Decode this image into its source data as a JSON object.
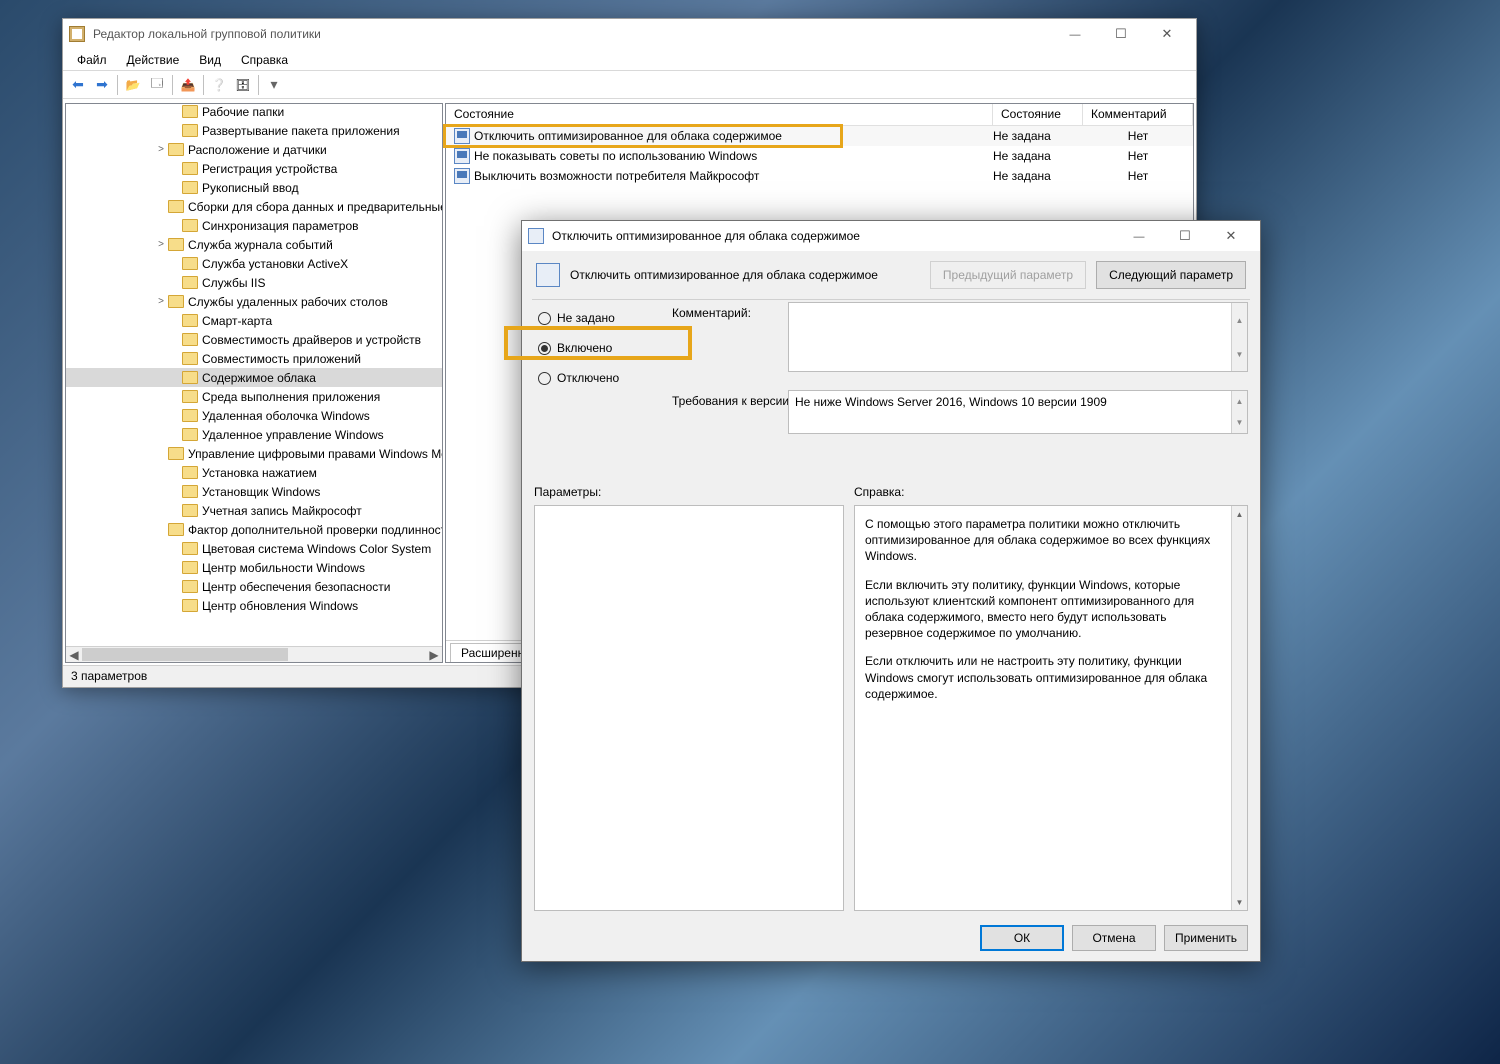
{
  "main": {
    "title": "Редактор локальной групповой политики",
    "menu": {
      "file": "Файл",
      "action": "Действие",
      "view": "Вид",
      "help": "Справка"
    },
    "status": "3 параметров",
    "tree": [
      {
        "indent": 3,
        "exp": "",
        "label": "Рабочие папки"
      },
      {
        "indent": 3,
        "exp": "",
        "label": "Развертывание пакета приложения"
      },
      {
        "indent": 2,
        "exp": ">",
        "label": "Расположение и датчики"
      },
      {
        "indent": 3,
        "exp": "",
        "label": "Регистрация устройства"
      },
      {
        "indent": 3,
        "exp": "",
        "label": "Рукописный ввод"
      },
      {
        "indent": 3,
        "exp": "",
        "label": "Сборки для сбора данных и предварительные сборки"
      },
      {
        "indent": 3,
        "exp": "",
        "label": "Синхронизация параметров"
      },
      {
        "indent": 2,
        "exp": ">",
        "label": "Служба журнала событий"
      },
      {
        "indent": 3,
        "exp": "",
        "label": "Служба установки ActiveX"
      },
      {
        "indent": 3,
        "exp": "",
        "label": "Службы IIS"
      },
      {
        "indent": 2,
        "exp": ">",
        "label": "Службы удаленных рабочих столов"
      },
      {
        "indent": 3,
        "exp": "",
        "label": "Смарт-карта"
      },
      {
        "indent": 3,
        "exp": "",
        "label": "Совместимость драйверов и устройств"
      },
      {
        "indent": 3,
        "exp": "",
        "label": "Совместимость приложений"
      },
      {
        "indent": 3,
        "exp": "",
        "label": "Содержимое облака",
        "sel": true
      },
      {
        "indent": 3,
        "exp": "",
        "label": "Среда выполнения приложения"
      },
      {
        "indent": 3,
        "exp": "",
        "label": "Удаленная оболочка Windows"
      },
      {
        "indent": 3,
        "exp": "",
        "label": "Удаленное управление Windows"
      },
      {
        "indent": 3,
        "exp": "",
        "label": "Управление цифровыми правами Windows Media"
      },
      {
        "indent": 3,
        "exp": "",
        "label": "Установка нажатием"
      },
      {
        "indent": 3,
        "exp": "",
        "label": "Установщик Windows"
      },
      {
        "indent": 3,
        "exp": "",
        "label": "Учетная запись Майкрософт"
      },
      {
        "indent": 3,
        "exp": "",
        "label": "Фактор дополнительной проверки подлинности"
      },
      {
        "indent": 3,
        "exp": "",
        "label": "Цветовая система Windows Color System"
      },
      {
        "indent": 3,
        "exp": "",
        "label": "Центр мобильности Windows"
      },
      {
        "indent": 3,
        "exp": "",
        "label": "Центр обеспечения безопасности"
      },
      {
        "indent": 3,
        "exp": "",
        "label": "Центр обновления Windows"
      }
    ],
    "list": {
      "header": {
        "name": "Состояние",
        "state": "Состояние",
        "comment": "Комментарий"
      },
      "rows": [
        {
          "name": "Отключить оптимизированное для облака содержимое",
          "state": "Не задана",
          "comment": "Нет",
          "hl": true
        },
        {
          "name": "Не показывать советы по использованию Windows",
          "state": "Не задана",
          "comment": "Нет"
        },
        {
          "name": "Выключить возможности потребителя Майкрософт",
          "state": "Не задана",
          "comment": "Нет"
        }
      ],
      "tab": "Расширенный"
    }
  },
  "dialog": {
    "title": "Отключить оптимизированное для облака содержимое",
    "name": "Отключить оптимизированное для облака содержимое",
    "prev": "Предыдущий параметр",
    "next": "Следующий параметр",
    "radios": {
      "not": "Не задано",
      "on": "Включено",
      "off": "Отключено"
    },
    "labels": {
      "comment": "Комментарий:",
      "req": "Требования к версии:",
      "params": "Параметры:",
      "help": "Справка:"
    },
    "req": "Не ниже Windows Server 2016, Windows 10 версии 1909",
    "help": {
      "p1": "С помощью этого параметра политики можно отключить оптимизированное для облака содержимое во всех функциях Windows.",
      "p2": "Если включить эту политику, функции Windows, которые используют клиентский компонент оптимизированного для облака содержимого, вместо него будут использовать резервное содержимое по умолчанию.",
      "p3": "Если отключить или не настроить эту политику, функции Windows смогут использовать оптимизированное для облака содержимое."
    },
    "buttons": {
      "ok": "ОК",
      "cancel": "Отмена",
      "apply": "Применить"
    }
  }
}
